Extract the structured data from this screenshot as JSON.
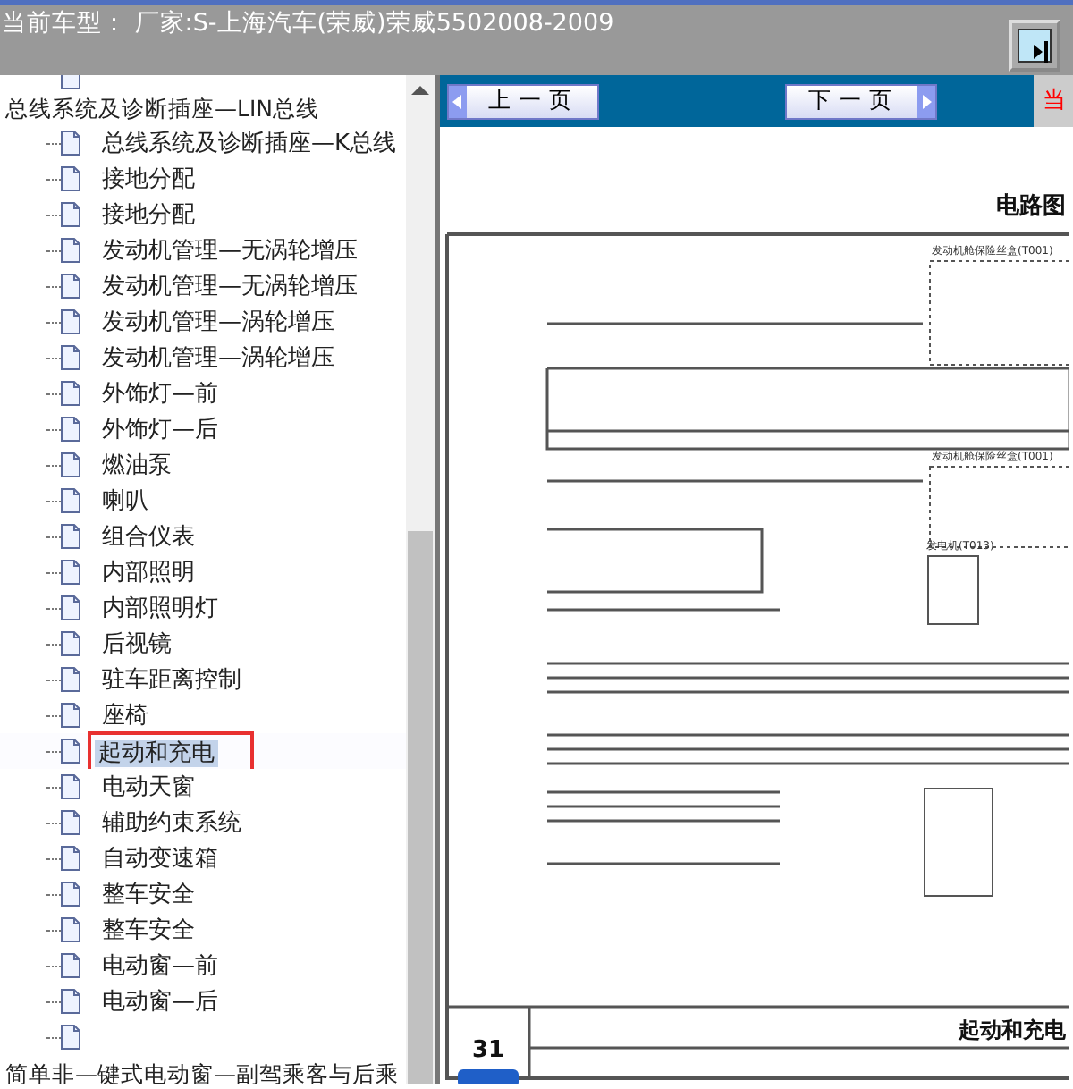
{
  "header": {
    "title": "当前车型：  厂家:S-上海汽车(荣威)荣威5502008-2009"
  },
  "tree": [
    {
      "label": "总线系统及诊断插座—LIN总线",
      "children": [
        {
          "label": "总线系统及诊断插座—K总线",
          "selected": false
        },
        {
          "label": "接地分配",
          "selected": false
        },
        {
          "label": "接地分配",
          "selected": false
        },
        {
          "label": "发动机管理—无涡轮增压",
          "selected": false
        },
        {
          "label": "发动机管理—无涡轮增压",
          "selected": false
        },
        {
          "label": "发动机管理—涡轮增压",
          "selected": false
        },
        {
          "label": "发动机管理—涡轮增压",
          "selected": false
        },
        {
          "label": "外饰灯—前",
          "selected": false
        },
        {
          "label": "外饰灯—后",
          "selected": false
        },
        {
          "label": "燃油泵",
          "selected": false
        },
        {
          "label": "喇叭",
          "selected": false
        },
        {
          "label": "组合仪表",
          "selected": false
        },
        {
          "label": "内部照明",
          "selected": false
        },
        {
          "label": "内部照明灯",
          "selected": false
        },
        {
          "label": "后视镜",
          "selected": false
        },
        {
          "label": "驻车距离控制",
          "selected": false
        },
        {
          "label": "座椅",
          "selected": false
        },
        {
          "label": "起动和充电",
          "selected": true
        },
        {
          "label": "电动天窗",
          "selected": false
        },
        {
          "label": "辅助约束系统",
          "selected": false
        },
        {
          "label": "自动变速箱",
          "selected": false
        },
        {
          "label": "整车安全",
          "selected": false
        },
        {
          "label": "整车安全",
          "selected": false
        },
        {
          "label": "电动窗—前",
          "selected": false
        },
        {
          "label": "电动窗—后",
          "selected": false
        },
        {
          "selected": false
        }
      ]
    },
    {
      "label": "简单非—键式电动窗—副驾乘客与后乘"
    }
  ],
  "toolbar": {
    "prev": "上 一 页",
    "next": "下 一 页",
    "status": "当"
  },
  "document": {
    "title": "电路图",
    "page_number": "31",
    "footer_title": "起动和充电",
    "labels": [
      "发动机舱保险丝盒(T001)",
      "发动机舱保险丝盒(T001)",
      "发电机(T013)"
    ]
  }
}
